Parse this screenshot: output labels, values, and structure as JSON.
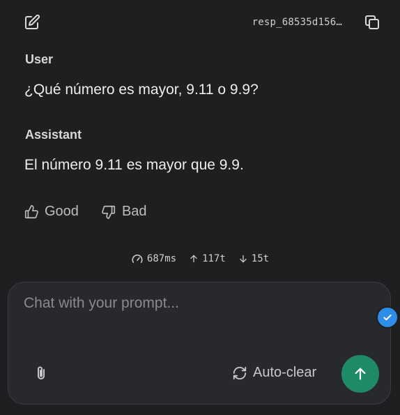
{
  "header": {
    "response_id": "resp_68535d156…",
    "edit_icon": "edit-icon",
    "copy_icon": "copy-icon"
  },
  "conversation": {
    "user_role": "User",
    "user_message": "¿Qué número es mayor, 9.11 o 9.9?",
    "assistant_role": "Assistant",
    "assistant_message": "El número 9.11 es mayor que 9.9."
  },
  "feedback": {
    "good_label": "Good",
    "bad_label": "Bad"
  },
  "stats": {
    "latency": "687ms",
    "tokens_in": "117t",
    "tokens_out": "15t"
  },
  "composer": {
    "placeholder": "Chat with your prompt...",
    "value": "",
    "autoclear_label": "Auto-clear"
  },
  "colors": {
    "send_button": "#1f8a66",
    "check_badge": "#2e8de6",
    "background": "#1e1f21"
  }
}
